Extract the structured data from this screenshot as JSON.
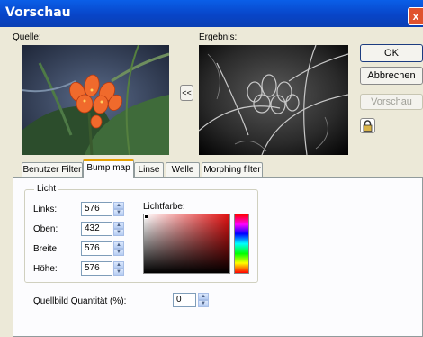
{
  "window": {
    "title": "Vorschau",
    "close_glyph": "x"
  },
  "preview": {
    "source_label": "Quelle:",
    "result_label": "Ergebnis:",
    "swap_button": "<<"
  },
  "buttons": {
    "ok": "OK",
    "cancel": "Abbrechen",
    "preview": "Vorschau"
  },
  "tabs": [
    {
      "label": "Benutzer Filter",
      "active": false
    },
    {
      "label": "Bump map",
      "active": true
    },
    {
      "label": "Linse",
      "active": false
    },
    {
      "label": "Welle",
      "active": false
    },
    {
      "label": "Morphing filter",
      "active": false
    }
  ],
  "light": {
    "group_label": "Licht",
    "fields": [
      {
        "label": "Links:",
        "value": "576"
      },
      {
        "label": "Oben:",
        "value": "432"
      },
      {
        "label": "Breite:",
        "value": "576"
      },
      {
        "label": "Höhe:",
        "value": "576"
      }
    ],
    "color_label": "Lichtfarbe:"
  },
  "quantity": {
    "label": "Quellbild Quantität (%):",
    "value": "0"
  },
  "icons": {
    "lock": "lock-icon",
    "spin_up": "up-arrow-icon",
    "spin_down": "down-arrow-icon"
  },
  "colors": {
    "titlebar": "#0A5FE8",
    "dialog": "#ECE9D8",
    "active_tab": "#E6A000"
  }
}
